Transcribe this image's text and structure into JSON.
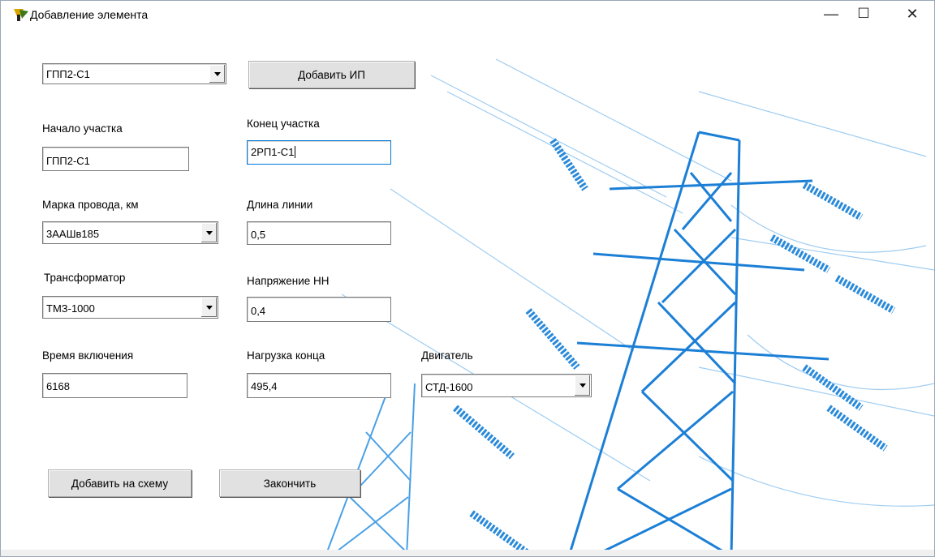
{
  "window": {
    "title": "Добавление элемента",
    "minimize_glyph": "—",
    "maximize_glyph": "☐",
    "close_glyph": "✕"
  },
  "form": {
    "source_select": {
      "value": "ГПП2-С1"
    },
    "add_source_button": "Добавить ИП",
    "segment_start": {
      "label": "Начало участка",
      "value": "ГПП2-С1"
    },
    "segment_end": {
      "label": "Конец участка",
      "value": "2РП1-С1"
    },
    "wire_brand": {
      "label": "Марка провода, км",
      "value": "3ААШв185"
    },
    "line_length": {
      "label": "Длина линии",
      "value": "0,5"
    },
    "transformer": {
      "label": "Трансформатор",
      "value": "ТМЗ-1000"
    },
    "voltage_lv": {
      "label": "Напряжение НН",
      "value": "0,4"
    },
    "on_time": {
      "label": "Время включения",
      "value": "6168"
    },
    "end_load": {
      "label": "Нагрузка конца",
      "value": "495,4"
    },
    "motor": {
      "label": "Двигатель",
      "value": "СТД-1600"
    },
    "add_to_scheme_button": "Добавить на схему",
    "finish_button": "Закончить"
  },
  "colors": {
    "art_blue": "#1c7fd6",
    "art_light": "#8ec4ef",
    "focus": "#0078d7"
  },
  "icons": [
    "app-icon",
    "minimize-icon",
    "maximize-icon",
    "close-icon",
    "dropdown-arrow-icon"
  ]
}
